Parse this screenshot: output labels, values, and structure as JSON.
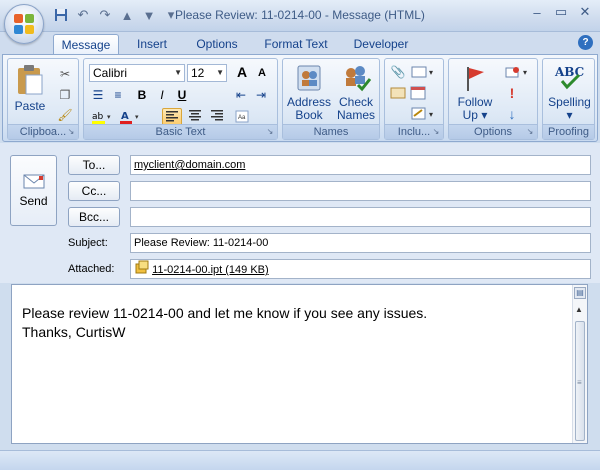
{
  "window": {
    "title": "Please Review: 11-0214-00 - Message (HTML)",
    "minimize_glyph": "–",
    "restore_glyph": "▭",
    "close_glyph": "✕"
  },
  "qat": {
    "save_icon": "save-icon",
    "undo_icon": "undo-icon",
    "redo_icon": "redo-icon",
    "up_icon": "previous-item-icon",
    "down_icon": "next-item-icon",
    "customize_glyph": "▾"
  },
  "tabs": [
    {
      "label": "Message",
      "active": true
    },
    {
      "label": "Insert"
    },
    {
      "label": "Options"
    },
    {
      "label": "Format Text"
    },
    {
      "label": "Developer"
    }
  ],
  "help_glyph": "?",
  "ribbon": {
    "clipboard": {
      "label": "Clipboa...",
      "paste": "Paste"
    },
    "basic_text": {
      "label": "Basic Text",
      "font_name": "Calibri",
      "font_size": "12",
      "bold": "B",
      "italic": "I",
      "underline": "U",
      "grow_font": "A",
      "shrink_font": "A"
    },
    "names": {
      "label": "Names",
      "address_book": [
        "Address",
        "Book"
      ],
      "check_names": [
        "Check",
        "Names"
      ]
    },
    "include": {
      "label": "Inclu..."
    },
    "options": {
      "label": "Options",
      "follow_up": [
        "Follow",
        "Up ▾"
      ]
    },
    "proofing": {
      "label": "Proofing",
      "spelling": [
        "Spelling",
        "▾"
      ],
      "abc": "ABC"
    }
  },
  "form": {
    "send_label": "Send",
    "to_label": "To...",
    "cc_label": "Cc...",
    "bcc_label": "Bcc...",
    "to_value": "myclient@domain.com",
    "cc_value": "",
    "bcc_value": "",
    "subject_label": "Subject:",
    "subject_value": "Please Review: 11-0214-00",
    "attached_label": "Attached:",
    "attachment": "11-0214-00.ipt (149 KB)"
  },
  "body": {
    "line1": "Please review 11-0214-00 and let me know if you see any issues.",
    "line2": "Thanks, CurtisW"
  },
  "colors": {
    "highlight": "#ffff00",
    "font_color": "#e02020",
    "ribbon_text": "#15428b"
  }
}
